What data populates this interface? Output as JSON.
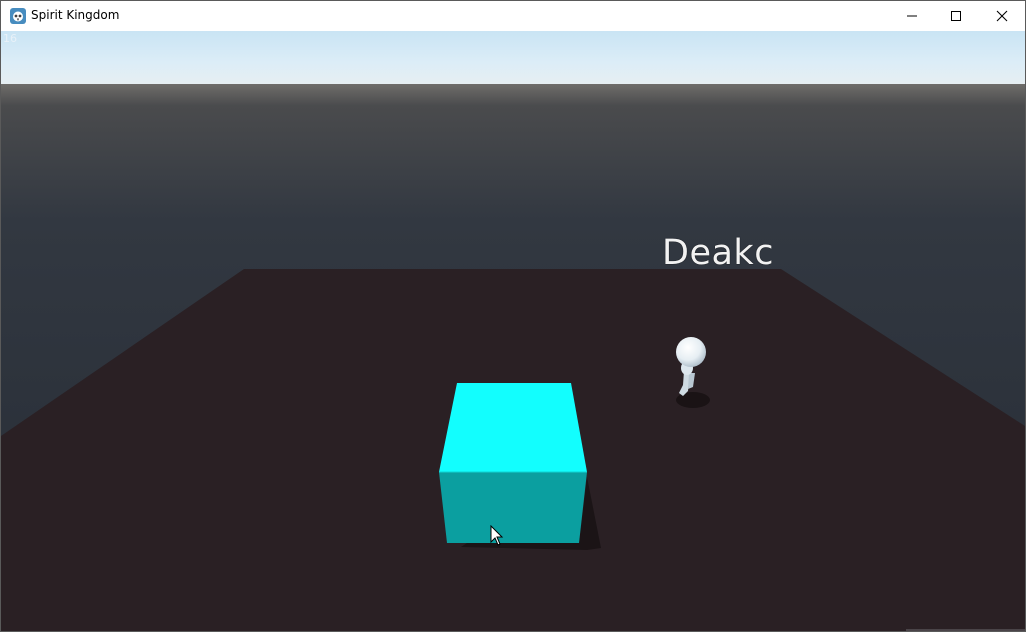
{
  "window": {
    "title": "Spirit Kingdom",
    "icon": "godot-engine-icon",
    "controls": [
      "minimize-icon",
      "maximize-icon",
      "close-icon"
    ]
  },
  "hud": {
    "fps": "16",
    "player_name": "Deakc"
  },
  "scene": {
    "sky_color": "#cfe7f5",
    "horizon_color": "#2a313a",
    "ground_color": "#2a2024",
    "cube_color": "#12fefe",
    "player_color": "#eef4f8"
  }
}
